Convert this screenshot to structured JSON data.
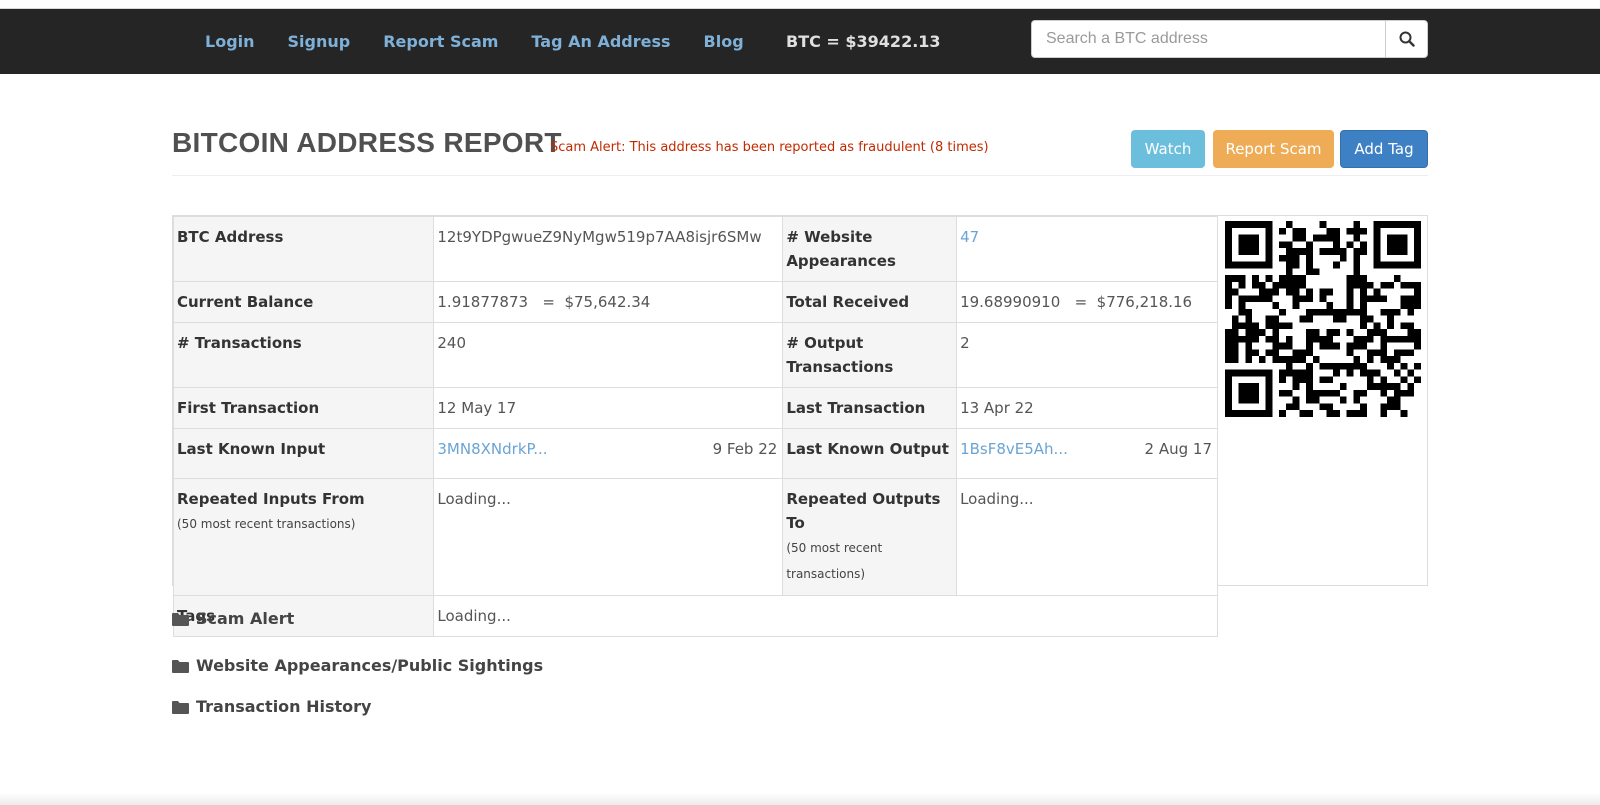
{
  "nav": {
    "links": [
      "Login",
      "Signup",
      "Report Scam",
      "Tag An Address",
      "Blog"
    ],
    "price": "BTC = $39422.13",
    "search_placeholder": "Search a BTC address"
  },
  "header": {
    "title": "BITCOIN ADDRESS REPORT",
    "alert": "Scam Alert: This address has been reported as fraudulent (8 times)",
    "buttons": {
      "watch": "Watch",
      "report": "Report Scam",
      "add_tag": "Add Tag"
    }
  },
  "report": {
    "btc_address_label": "BTC Address",
    "btc_address": "12t9YDPgwueZ9NyMgw519p7AA8isjr6SMw",
    "website_appearances_label": "# Website Appearances",
    "website_appearances": "47",
    "current_balance_label": "Current Balance",
    "current_balance": "1.91877873   =  $75,642.34",
    "total_received_label": "Total Received",
    "total_received": "19.68990910   =  $776,218.16",
    "transactions_label": "# Transactions",
    "transactions": "240",
    "output_transactions_label": "# Output Transactions",
    "output_transactions": "2",
    "first_tx_label": "First Transaction",
    "first_tx": "12 May 17",
    "last_tx_label": "Last Transaction",
    "last_tx": "13 Apr 22",
    "last_input_label": "Last Known Input",
    "last_input_addr": "3MN8XNdrkP...",
    "last_input_date": "9 Feb 22",
    "last_output_label": "Last Known Output",
    "last_output_addr": "1BsF8vE5Ah...",
    "last_output_date": "2 Aug 17",
    "repeated_inputs_label": "Repeated Inputs From",
    "repeated_inputs_sub": "(50 most recent transactions)",
    "repeated_inputs": "Loading...",
    "repeated_outputs_label": "Repeated Outputs To",
    "repeated_outputs_sub": "(50 most recent transactions)",
    "repeated_outputs": "Loading...",
    "tags_label": "Tags",
    "tags": "Loading..."
  },
  "sections": [
    "Scam Alert",
    "Website Appearances/Public Sightings",
    "Transaction History"
  ],
  "icons": {
    "search": "search-icon",
    "folder": "folder-icon",
    "qr": "qr-code"
  },
  "colors": {
    "navbar": "#252525",
    "nav_link": "#7fb0d8",
    "alert": "#c22a00",
    "watch": "#6bbfdd",
    "report": "#efac56",
    "add_tag": "#3e80c4",
    "link": "#6aa4d4"
  }
}
